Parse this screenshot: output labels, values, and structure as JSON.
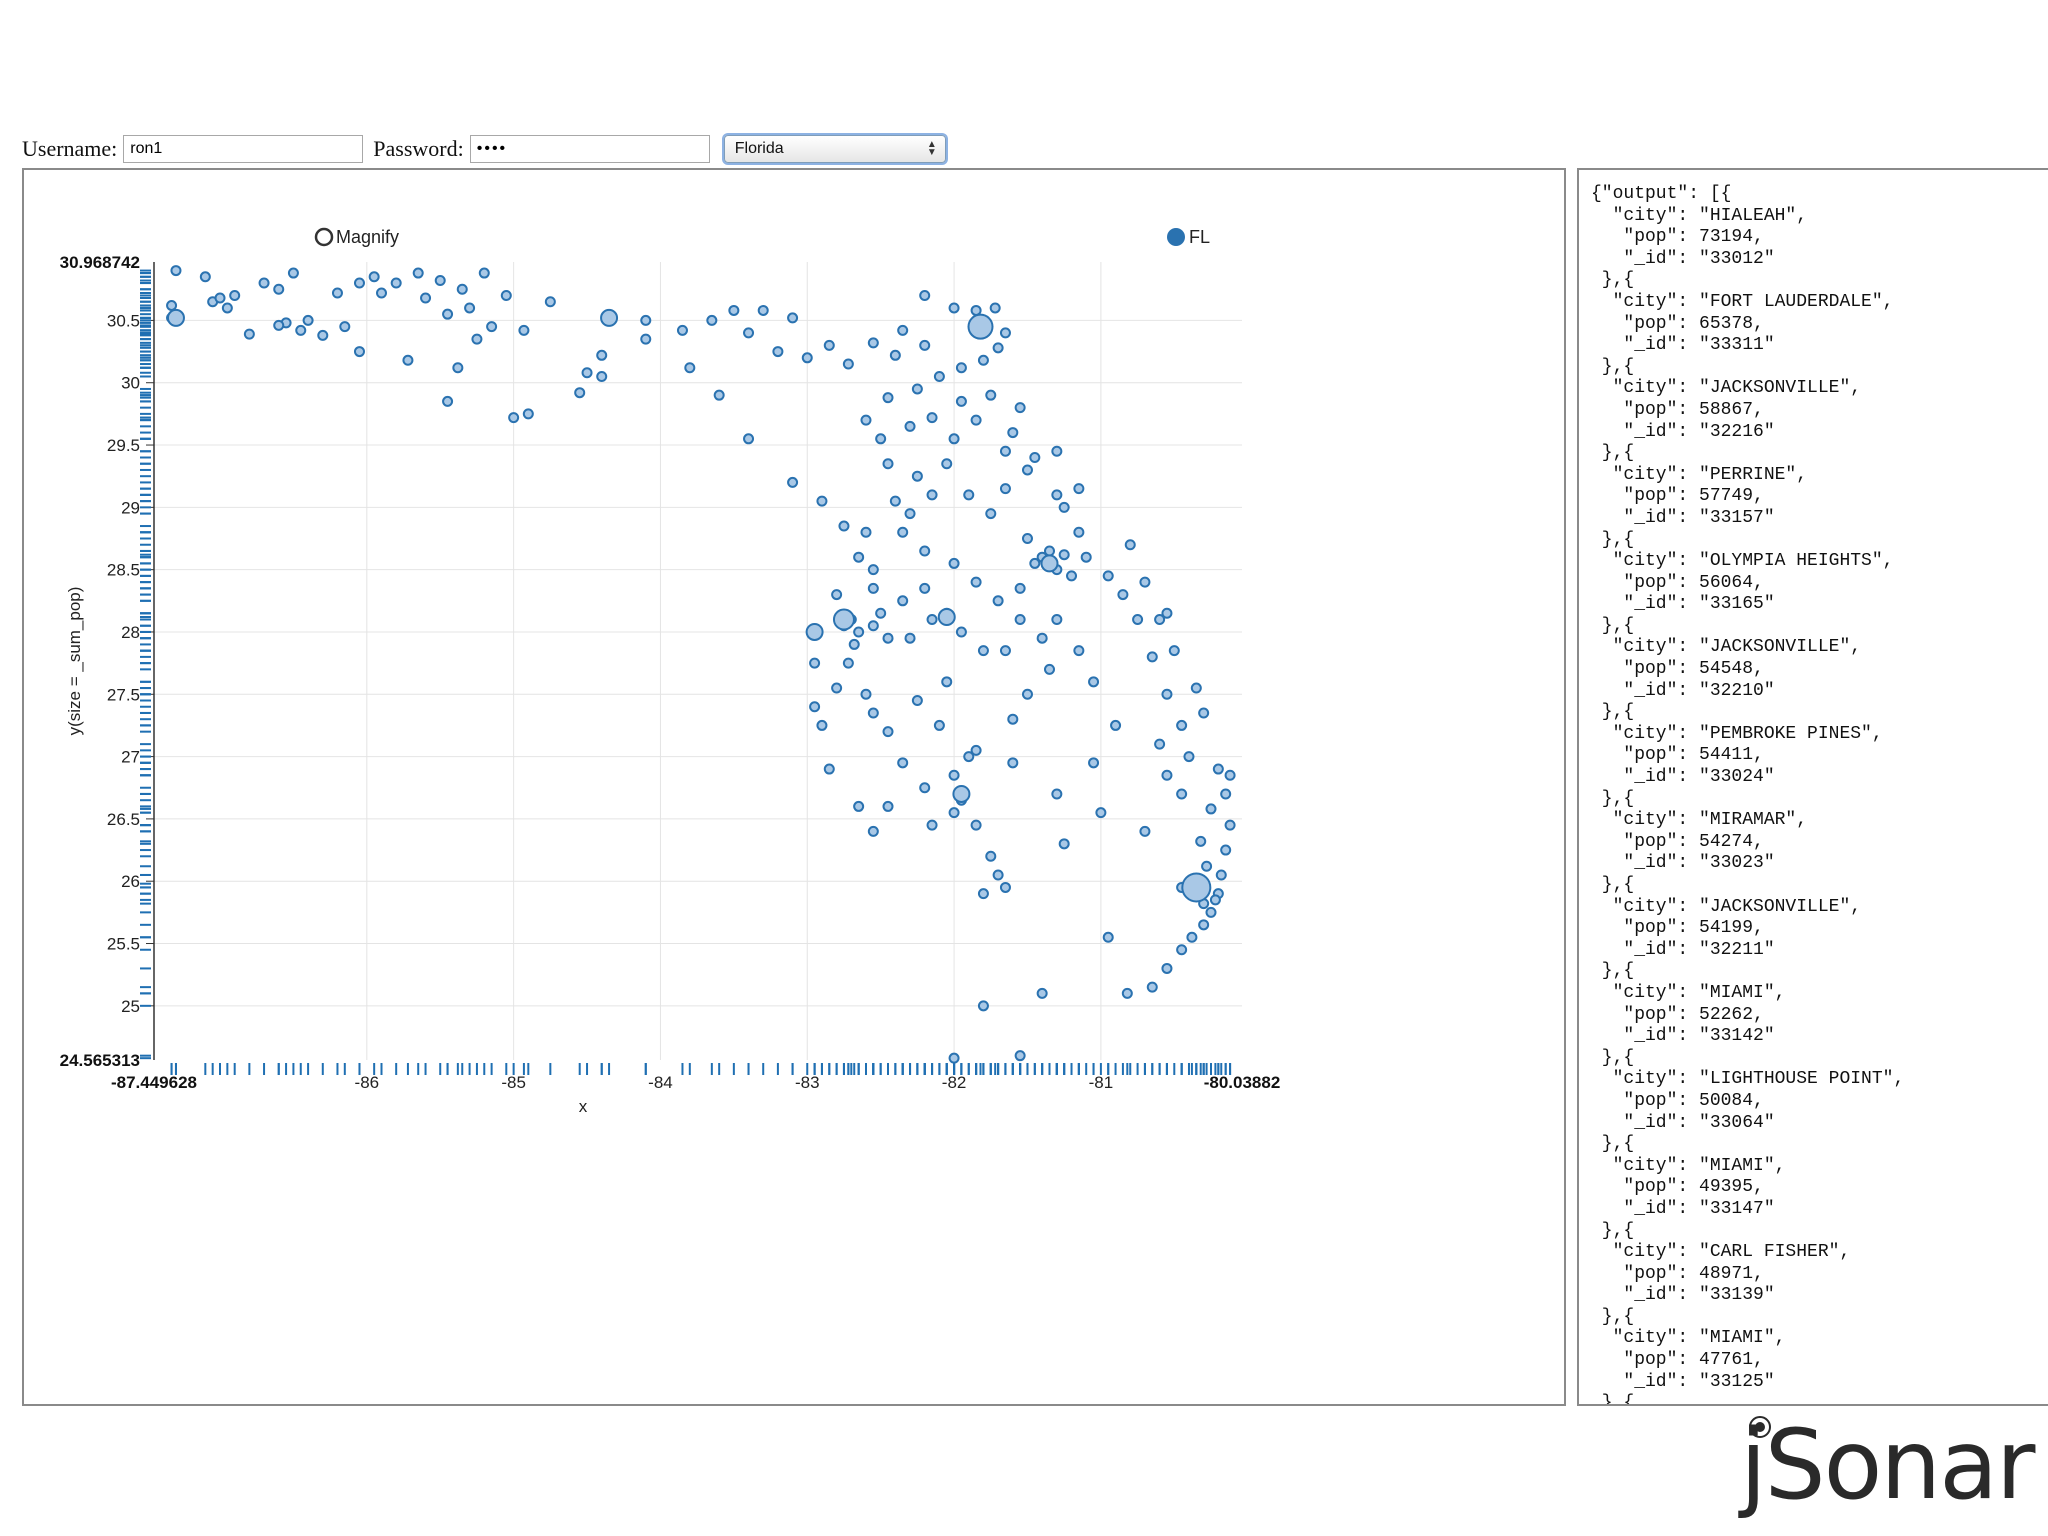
{
  "login": {
    "username_label": "Username:",
    "username_value": "ron1",
    "password_label": "Password:",
    "password_value": "••••",
    "state_selected": "Florida"
  },
  "logo_text": "jSonar",
  "colors": {
    "point_fill": "#a9c8e6",
    "point_stroke": "#2a72b0",
    "rug": "#1f6fb2",
    "grid": "#e4e4e4"
  },
  "json_output": "{\"output\": [{\n  \"city\": \"HIALEAH\",\n   \"pop\": 73194,\n   \"_id\": \"33012\"\n },{\n  \"city\": \"FORT LAUDERDALE\",\n   \"pop\": 65378,\n   \"_id\": \"33311\"\n },{\n  \"city\": \"JACKSONVILLE\",\n   \"pop\": 58867,\n   \"_id\": \"32216\"\n },{\n  \"city\": \"PERRINE\",\n   \"pop\": 57749,\n   \"_id\": \"33157\"\n },{\n  \"city\": \"OLYMPIA HEIGHTS\",\n   \"pop\": 56064,\n   \"_id\": \"33165\"\n },{\n  \"city\": \"JACKSONVILLE\",\n   \"pop\": 54548,\n   \"_id\": \"32210\"\n },{\n  \"city\": \"PEMBROKE PINES\",\n   \"pop\": 54411,\n   \"_id\": \"33024\"\n },{\n  \"city\": \"MIRAMAR\",\n   \"pop\": 54274,\n   \"_id\": \"33023\"\n },{\n  \"city\": \"JACKSONVILLE\",\n   \"pop\": 54199,\n   \"_id\": \"32211\"\n },{\n  \"city\": \"MIAMI\",\n   \"pop\": 52262,\n   \"_id\": \"33142\"\n },{\n  \"city\": \"LIGHTHOUSE POINT\",\n   \"pop\": 50084,\n   \"_id\": \"33064\"\n },{\n  \"city\": \"MIAMI\",\n   \"pop\": 49395,\n   \"_id\": \"33147\"\n },{\n  \"city\": \"CARL FISHER\",\n   \"pop\": 48971,\n   \"_id\": \"33139\"\n },{\n  \"city\": \"MIAMI\",\n   \"pop\": 47761,\n   \"_id\": \"33125\"\n },{",
  "chart_data": {
    "type": "scatter",
    "xlabel": "x",
    "ylabel": "y(size = _sum_pop)",
    "magnify_label": "Magnify",
    "legend": [
      {
        "name": "FL",
        "position": "top-right"
      }
    ],
    "xlim": [
      -87.449628,
      -80.038821
    ],
    "ylim": [
      24.565313,
      30.968742
    ],
    "xlim_labels": [
      "-87.449628",
      "-80.03882"
    ],
    "ylim_labels": [
      "24.565313",
      "30.968742"
    ],
    "x_ticks": [
      "-86",
      "-85",
      "-84",
      "-83",
      "-82",
      "-81"
    ],
    "x_tick_values": [
      -86,
      -85,
      -84,
      -83,
      -82,
      -81
    ],
    "y_ticks": [
      "25",
      "25.5",
      "26",
      "26.5",
      "27",
      "27.5",
      "28",
      "28.5",
      "29",
      "29.5",
      "30",
      "30.5"
    ],
    "y_tick_values": [
      25,
      25.5,
      26,
      26.5,
      27,
      27.5,
      28,
      28.5,
      29,
      29.5,
      30,
      30.5
    ],
    "grid": true,
    "points": [
      [
        -87.3,
        30.9
      ],
      [
        -87.1,
        30.85
      ],
      [
        -86.9,
        30.7
      ],
      [
        -87.33,
        30.52
      ],
      [
        -87.33,
        30.62
      ],
      [
        -87.05,
        30.65
      ],
      [
        -87.0,
        30.68
      ],
      [
        -86.95,
        30.6
      ],
      [
        -86.8,
        30.39
      ],
      [
        -86.7,
        30.8
      ],
      [
        -86.6,
        30.75
      ],
      [
        -86.5,
        30.88
      ],
      [
        -86.55,
        30.48
      ],
      [
        -86.6,
        30.46
      ],
      [
        -86.45,
        30.42
      ],
      [
        -86.4,
        30.5
      ],
      [
        -86.3,
        30.38
      ],
      [
        -86.15,
        30.45
      ],
      [
        -86.2,
        30.72
      ],
      [
        -86.05,
        30.8
      ],
      [
        -85.95,
        30.85
      ],
      [
        -85.9,
        30.72
      ],
      [
        -85.8,
        30.8
      ],
      [
        -85.65,
        30.88
      ],
      [
        -85.6,
        30.68
      ],
      [
        -85.5,
        30.82
      ],
      [
        -85.45,
        30.55
      ],
      [
        -85.35,
        30.75
      ],
      [
        -85.3,
        30.6
      ],
      [
        -85.2,
        30.88
      ],
      [
        -85.15,
        30.45
      ],
      [
        -85.05,
        30.7
      ],
      [
        -85.25,
        30.35
      ],
      [
        -85.38,
        30.12
      ],
      [
        -84.93,
        30.42
      ],
      [
        -84.75,
        30.65
      ],
      [
        -86.05,
        30.25
      ],
      [
        -85.72,
        30.18
      ],
      [
        -85.45,
        29.85
      ],
      [
        -85.0,
        29.72
      ],
      [
        -84.9,
        29.75
      ],
      [
        -84.55,
        29.92
      ],
      [
        -84.5,
        30.08
      ],
      [
        -84.4,
        30.22
      ],
      [
        -84.4,
        30.05
      ],
      [
        -84.1,
        30.5
      ],
      [
        -84.1,
        30.35
      ],
      [
        -83.85,
        30.42
      ],
      [
        -83.8,
        30.12
      ],
      [
        -83.65,
        30.5
      ],
      [
        -83.5,
        30.58
      ],
      [
        -83.4,
        30.4
      ],
      [
        -83.3,
        30.58
      ],
      [
        -83.1,
        30.52
      ],
      [
        -83.2,
        30.25
      ],
      [
        -83.0,
        30.2
      ],
      [
        -82.85,
        30.3
      ],
      [
        -82.72,
        30.15
      ],
      [
        -82.55,
        30.32
      ],
      [
        -82.4,
        30.22
      ],
      [
        -82.35,
        30.42
      ],
      [
        -82.2,
        30.7
      ],
      [
        -82.2,
        30.3
      ],
      [
        -82.0,
        30.6
      ],
      [
        -81.85,
        30.58
      ],
      [
        -81.72,
        30.6
      ],
      [
        -81.65,
        30.4
      ],
      [
        -81.7,
        30.28
      ],
      [
        -81.8,
        30.18
      ],
      [
        -81.95,
        30.12
      ],
      [
        -82.1,
        30.05
      ],
      [
        -82.25,
        29.95
      ],
      [
        -82.45,
        29.88
      ],
      [
        -82.6,
        29.7
      ],
      [
        -82.5,
        29.55
      ],
      [
        -82.3,
        29.65
      ],
      [
        -82.15,
        29.72
      ],
      [
        -81.95,
        29.85
      ],
      [
        -81.75,
        29.9
      ],
      [
        -81.6,
        29.6
      ],
      [
        -81.65,
        29.45
      ],
      [
        -81.45,
        29.4
      ],
      [
        -81.3,
        29.1
      ],
      [
        -81.25,
        29.0
      ],
      [
        -81.15,
        28.8
      ],
      [
        -81.1,
        28.6
      ],
      [
        -80.95,
        28.45
      ],
      [
        -80.85,
        28.3
      ],
      [
        -80.75,
        28.1
      ],
      [
        -80.65,
        27.8
      ],
      [
        -80.55,
        27.5
      ],
      [
        -80.45,
        27.25
      ],
      [
        -80.4,
        27.0
      ],
      [
        -80.2,
        26.9
      ],
      [
        -80.15,
        26.7
      ],
      [
        -80.12,
        26.45
      ],
      [
        -80.15,
        26.25
      ],
      [
        -80.18,
        26.05
      ],
      [
        -80.2,
        25.9
      ],
      [
        -80.25,
        25.75
      ],
      [
        -80.3,
        25.65
      ],
      [
        -80.38,
        25.55
      ],
      [
        -80.45,
        25.45
      ],
      [
        -80.55,
        25.3
      ],
      [
        -80.65,
        25.15
      ],
      [
        -80.82,
        25.1
      ],
      [
        -80.22,
        25.85
      ],
      [
        -80.3,
        25.82
      ],
      [
        -80.35,
        25.98
      ],
      [
        -80.28,
        26.12
      ],
      [
        -80.32,
        26.32
      ],
      [
        -80.25,
        26.58
      ],
      [
        -80.45,
        26.7
      ],
      [
        -80.55,
        26.85
      ],
      [
        -80.6,
        27.1
      ],
      [
        -81.0,
        26.55
      ],
      [
        -80.45,
        25.95
      ],
      [
        -80.7,
        26.4
      ],
      [
        -83.6,
        29.9
      ],
      [
        -83.4,
        29.55
      ],
      [
        -83.1,
        29.2
      ],
      [
        -82.9,
        29.05
      ],
      [
        -82.75,
        28.85
      ],
      [
        -82.65,
        28.6
      ],
      [
        -82.8,
        28.3
      ],
      [
        -82.75,
        28.05
      ],
      [
        -82.68,
        27.9
      ],
      [
        -82.72,
        27.75
      ],
      [
        -82.6,
        27.5
      ],
      [
        -82.55,
        27.35
      ],
      [
        -82.45,
        27.2
      ],
      [
        -82.35,
        26.95
      ],
      [
        -82.2,
        26.75
      ],
      [
        -82.0,
        26.55
      ],
      [
        -81.85,
        26.45
      ],
      [
        -81.75,
        26.2
      ],
      [
        -81.7,
        26.05
      ],
      [
        -82.0,
        26.85
      ],
      [
        -81.9,
        27.0
      ],
      [
        -81.6,
        27.3
      ],
      [
        -81.5,
        27.5
      ],
      [
        -81.35,
        27.7
      ],
      [
        -81.4,
        27.95
      ],
      [
        -81.55,
        28.1
      ],
      [
        -81.7,
        28.25
      ],
      [
        -81.85,
        28.4
      ],
      [
        -82.0,
        28.55
      ],
      [
        -82.2,
        28.65
      ],
      [
        -82.35,
        28.8
      ],
      [
        -82.4,
        29.05
      ],
      [
        -82.25,
        29.25
      ],
      [
        -82.05,
        29.35
      ],
      [
        -81.9,
        29.1
      ],
      [
        -81.75,
        28.95
      ],
      [
        -81.5,
        28.75
      ],
      [
        -81.35,
        28.65
      ],
      [
        -81.3,
        28.5
      ],
      [
        -81.45,
        28.55
      ],
      [
        -81.4,
        28.6
      ],
      [
        -81.25,
        28.62
      ],
      [
        -81.2,
        28.45
      ],
      [
        -81.55,
        28.35
      ],
      [
        -82.15,
        28.1
      ],
      [
        -82.3,
        27.95
      ],
      [
        -82.45,
        27.95
      ],
      [
        -82.55,
        28.05
      ],
      [
        -82.5,
        28.15
      ],
      [
        -82.35,
        28.25
      ],
      [
        -82.2,
        28.35
      ],
      [
        -82.05,
        28.15
      ],
      [
        -81.95,
        28.0
      ],
      [
        -81.8,
        27.85
      ],
      [
        -81.65,
        27.85
      ],
      [
        -82.05,
        27.6
      ],
      [
        -82.25,
        27.45
      ],
      [
        -82.1,
        27.25
      ],
      [
        -81.85,
        27.05
      ],
      [
        -81.6,
        26.95
      ],
      [
        -81.3,
        26.7
      ],
      [
        -81.05,
        26.95
      ],
      [
        -80.9,
        27.25
      ],
      [
        -81.05,
        27.6
      ],
      [
        -81.15,
        27.85
      ],
      [
        -81.3,
        28.1
      ],
      [
        -81.95,
        26.65
      ],
      [
        -82.15,
        26.45
      ],
      [
        -82.45,
        26.6
      ],
      [
        -81.65,
        25.95
      ],
      [
        -81.8,
        25.9
      ],
      [
        -82.55,
        26.4
      ],
      [
        -82.65,
        26.6
      ],
      [
        -82.85,
        26.9
      ],
      [
        -82.95,
        27.4
      ],
      [
        -82.95,
        27.75
      ],
      [
        -82.7,
        28.1
      ],
      [
        -82.55,
        28.35
      ],
      [
        -82.6,
        28.8
      ],
      [
        -82.45,
        29.35
      ],
      [
        -82.0,
        29.55
      ],
      [
        -81.85,
        29.7
      ],
      [
        -81.55,
        29.8
      ],
      [
        -81.3,
        29.45
      ],
      [
        -81.15,
        29.15
      ],
      [
        -81.5,
        29.3
      ],
      [
        -81.65,
        29.15
      ],
      [
        -82.15,
        29.1
      ],
      [
        -82.3,
        28.95
      ],
      [
        -82.55,
        28.5
      ],
      [
        -82.65,
        28.0
      ],
      [
        -82.8,
        27.55
      ],
      [
        -82.9,
        27.25
      ],
      [
        -81.25,
        26.3
      ],
      [
        -80.95,
        25.55
      ],
      [
        -80.3,
        27.35
      ],
      [
        -80.35,
        27.55
      ],
      [
        -80.5,
        27.85
      ],
      [
        -80.6,
        28.1
      ],
      [
        -80.7,
        28.4
      ],
      [
        -80.8,
        28.7
      ],
      [
        -80.55,
        28.15
      ],
      [
        -81.8,
        25.0
      ],
      [
        -81.4,
        25.1
      ],
      [
        -81.55,
        24.6
      ],
      [
        -82.0,
        24.58
      ],
      [
        -80.12,
        26.85
      ]
    ],
    "big_points": [
      [
        -87.3,
        30.52
      ],
      [
        -84.35,
        30.52
      ],
      [
        -81.82,
        30.45
      ],
      [
        -82.75,
        28.1
      ],
      [
        -80.35,
        25.95
      ],
      [
        -82.05,
        28.12
      ],
      [
        -81.95,
        26.7
      ],
      [
        -82.95,
        28.0
      ],
      [
        -81.35,
        28.55
      ]
    ]
  }
}
